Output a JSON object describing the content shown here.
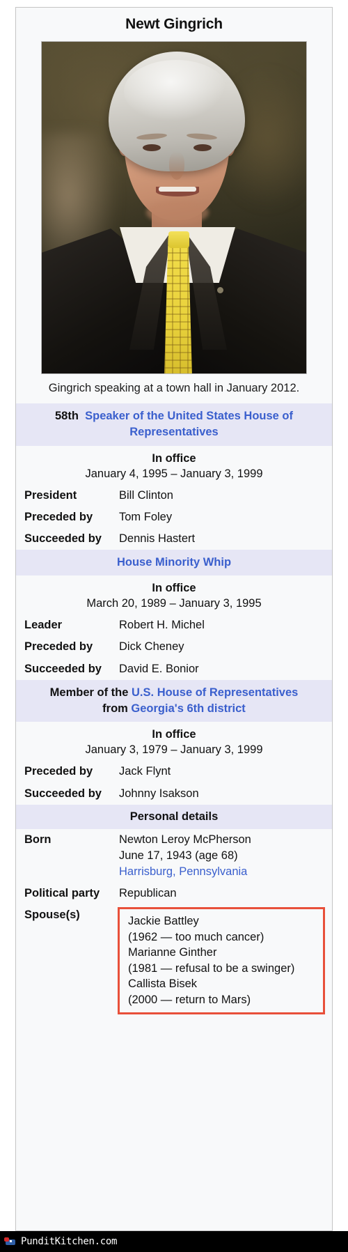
{
  "infobox": {
    "title": "Newt Gingrich",
    "photo_caption": "Gingrich speaking at a town hall in January 2012.",
    "photo_alt": "Newt Gingrich in dark suit and yellow patterned tie",
    "sections": [
      {
        "id": "speaker",
        "band": {
          "ordinal": "58th",
          "link": "Speaker of the United States House of Representatives"
        },
        "in_office_label": "In office",
        "term": "January 4, 1995 – January 3, 1999",
        "rows": [
          {
            "label": "President",
            "value": "Bill Clinton",
            "link": true
          },
          {
            "label": "Preceded by",
            "value": "Tom Foley",
            "link": true
          },
          {
            "label": "Succeeded by",
            "value": "Dennis Hastert",
            "link": true
          }
        ]
      },
      {
        "id": "whip",
        "band": {
          "ordinal": "",
          "link": "House Minority Whip"
        },
        "in_office_label": "In office",
        "term": "March 20, 1989 – January 3, 1995",
        "rows": [
          {
            "label": "Leader",
            "value": "Robert H. Michel",
            "link": true
          },
          {
            "label": "Preceded by",
            "value": "Dick Cheney",
            "link": true
          },
          {
            "label": "Succeeded by",
            "value": "David E. Bonior",
            "link": true
          }
        ]
      },
      {
        "id": "member",
        "band_member": {
          "prefix": "Member of the ",
          "link1": "U.S. House of Representatives",
          "from": "from ",
          "link2": "Georgia's 6th district"
        },
        "in_office_label": "In office",
        "term": "January 3, 1979 – January 3, 1999",
        "rows": [
          {
            "label": "Preceded by",
            "value": "Jack Flynt",
            "link": true
          },
          {
            "label": "Succeeded by",
            "value": "Johnny Isakson",
            "link": true
          }
        ]
      }
    ],
    "personal": {
      "band": "Personal details",
      "born_label": "Born",
      "born_name": "Newton Leroy McPherson",
      "born_date": "June 17, 1943 (age 68)",
      "born_place": "Harrisburg, Pennsylvania",
      "party_label": "Political party",
      "party_value": "Republican",
      "spouse_label": "Spouse(s)",
      "spouses": [
        {
          "name": "Jackie Battley",
          "note": "(1962 — too much cancer)",
          "link": false
        },
        {
          "name": "Marianne Ginther",
          "note": "(1981 — refusal to be a swinger)",
          "link": false
        },
        {
          "name": "Callista Bisek",
          "note": "(2000 — return to Mars)",
          "link": true
        }
      ]
    }
  },
  "watermark": {
    "text": "PunditKitchen.com",
    "icon": "democrat-donkey-icon"
  },
  "colors": {
    "link": "#3a5fcd",
    "band_bg": "#e6e6f5",
    "box_bg": "#f8f9fa",
    "border": "#c4c4c4",
    "highlight": "#e8503a",
    "watermark_bg": "#000000"
  }
}
